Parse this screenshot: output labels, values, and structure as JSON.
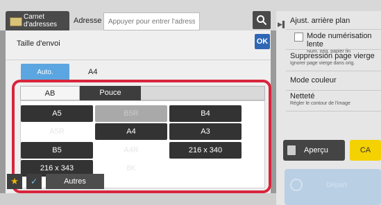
{
  "header": {
    "address_book_label": "Carnet\nd'adresses",
    "address_label": "Adresse",
    "address_placeholder": "Appuyer pour entrer l'adresse"
  },
  "right_panel": {
    "items": [
      {
        "title": "Ajust. arrière plan",
        "sub": ""
      },
      {
        "title": "Mode numérisation lente",
        "sub": "Num. orig. papier fin"
      },
      {
        "title": "Suppression page vierge",
        "sub": "Ignorer page vierge dans orig."
      },
      {
        "title": "Mode couleur",
        "sub": ""
      },
      {
        "title": "Netteté",
        "sub": "Régler le contour de l'image"
      }
    ],
    "preview_label": "Aperçu",
    "ca_label": "CA",
    "start_label": "Départ"
  },
  "dialog": {
    "title": "Taille d'envoi",
    "ok_label": "OK",
    "auto_label": "Auto.",
    "current_size": "A4"
  },
  "tabs": [
    {
      "label": "AB",
      "active": true
    },
    {
      "label": "Pouce",
      "active": false
    }
  ],
  "sizes": [
    {
      "label": "A5",
      "state": "on"
    },
    {
      "label": "B5R",
      "state": "off"
    },
    {
      "label": "B4",
      "state": "on"
    },
    {
      "label": "A5R",
      "state": "ghost"
    },
    {
      "label": "A4",
      "state": "on"
    },
    {
      "label": "A3",
      "state": "on"
    },
    {
      "label": "B5",
      "state": "on"
    },
    {
      "label": "A4R",
      "state": "ghost"
    },
    {
      "label": "216 x 340",
      "state": "on"
    },
    {
      "label": "216 x 343",
      "state": "on"
    },
    {
      "label": "8K",
      "state": "ghost"
    }
  ],
  "bottom": {
    "others_label": "Autres"
  },
  "colors": {
    "accent": "#2f67b5",
    "auto_button": "#5ba6e0",
    "highlight_frame": "#d8253c",
    "ca_button": "#f4d100"
  }
}
